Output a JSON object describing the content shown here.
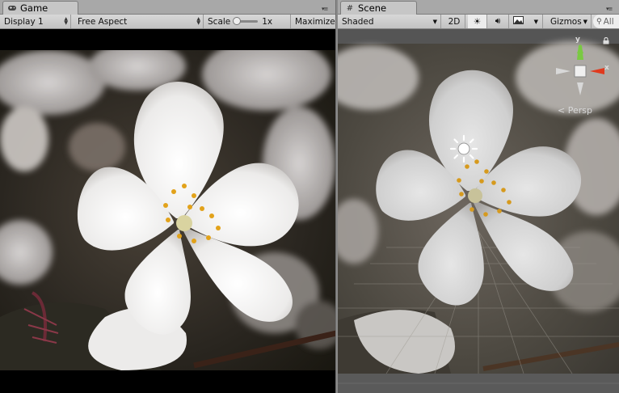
{
  "game": {
    "tab_label": "Game",
    "display": "Display 1",
    "aspect": "Free Aspect",
    "scale_label": "Scale",
    "scale_value": "1x",
    "maximize": "Maximize"
  },
  "scene": {
    "tab_label": "Scene",
    "shading": "Shaded",
    "mode_2d": "2D",
    "gizmos": "Gizmos",
    "search_partial": "All",
    "persp_label": "Persp",
    "axis_y": "y",
    "axis_x": "x"
  },
  "icons": {
    "game_tab": "gamepad-icon",
    "scene_tab": "hash-icon",
    "lighting": "sun-icon",
    "audio": "speaker-icon",
    "effects": "image-icon",
    "light_gizmo": "light-source-icon",
    "lock": "lock-icon"
  },
  "colors": {
    "editor_bg": "#a2a2a2",
    "toolbar_bg": "#c8c8c8",
    "gizmo_x": "#e03a1e",
    "gizmo_y": "#7ac943"
  }
}
